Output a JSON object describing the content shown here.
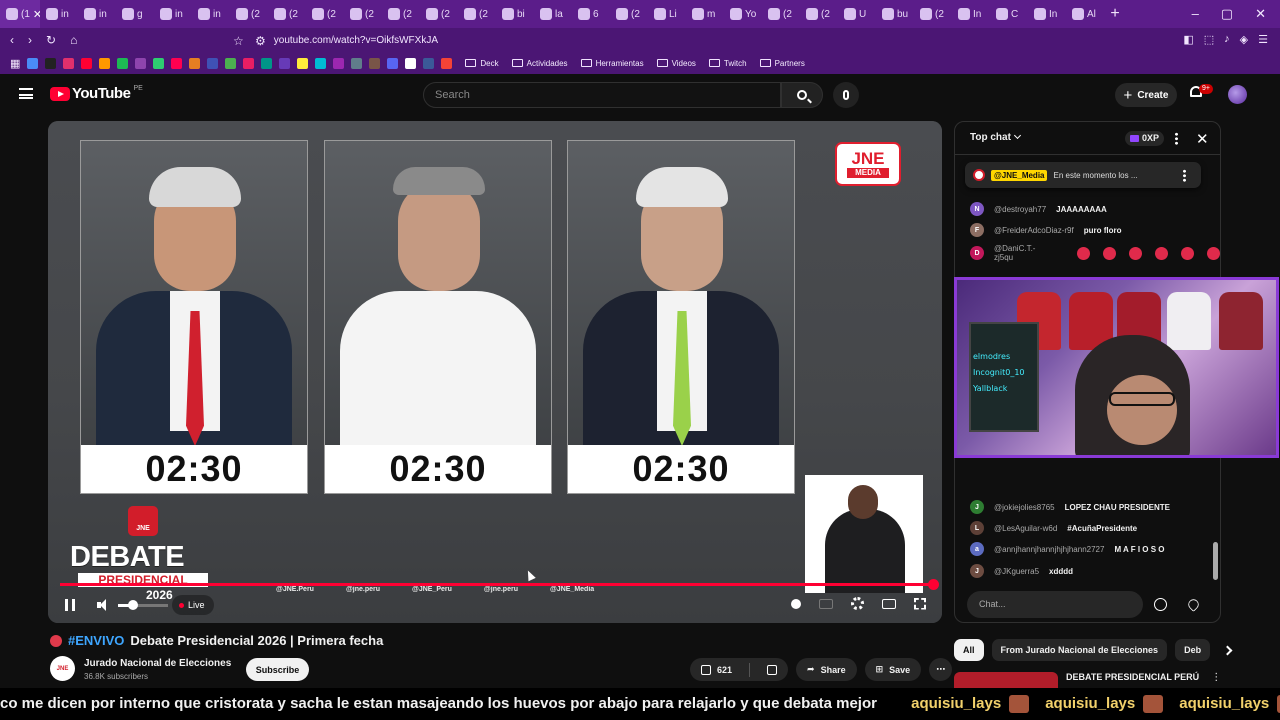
{
  "browser": {
    "tabs": [
      "(1",
      "in",
      "in",
      "g",
      "in",
      "in",
      "(2",
      "(2",
      "(2",
      "(2",
      "(2",
      "(2",
      "(2",
      "bi",
      "la",
      "6",
      "(2",
      "Li",
      "m",
      "Yo",
      "(2",
      "(2",
      "U",
      "bu",
      "(2",
      "In",
      "C",
      "In",
      "Al"
    ],
    "url": "youtube.com/watch?v=OikfsWFXkJA",
    "bookmarks": [
      {
        "label": "Deck"
      },
      {
        "label": "Actividades"
      },
      {
        "label": "Herramientas"
      },
      {
        "label": "Videos"
      },
      {
        "label": "Twitch"
      },
      {
        "label": "Partners"
      }
    ]
  },
  "yt": {
    "logo": "YouTube",
    "region": "PE",
    "search_placeholder": "Search",
    "create_label": "Create",
    "notif_badge": "9+"
  },
  "player": {
    "timers": [
      "02:30",
      "02:30",
      "02:30"
    ],
    "jne_logo_top": "JNE",
    "jne_logo_bottom": "MEDIA",
    "debate_badge": "JNE",
    "debate_line1": "DEBATE",
    "debate_line2": "PRESIDENCIAL",
    "debate_line3": "2026",
    "socials": [
      "@JNE.Peru",
      "@jne.peru",
      "@JNE_Peru",
      "@jne.peru",
      "@JNE_Media"
    ],
    "live_label": "Live",
    "volume_fraction": 0.3
  },
  "video": {
    "hashtag": "#ENVIVO",
    "title": "Debate Presidencial 2026 | Primera fecha",
    "channel": "Jurado Nacional de Elecciones",
    "channel_avatar_text": "JNE",
    "subscribers": "36.8K subscribers",
    "subscribe_label": "Subscribe",
    "likes": "621",
    "share_label": "Share",
    "save_label": "Save"
  },
  "chat": {
    "title": "Top chat",
    "xp_label": "0XP",
    "pinned_author": "@JNE_Media",
    "pinned_text": "En este momento los ...",
    "messages": [
      {
        "initial": "N",
        "color": "#7e57c2",
        "author": "@destroyah77",
        "text": "JAAAAAAAA"
      },
      {
        "initial": "F",
        "color": "#8d6e63",
        "author": "@FreiderAdcoDiaz-r9f",
        "text": "puro floro"
      },
      {
        "initial": "D",
        "color": "#c2185b",
        "author": "@DaniC.T.-zj5qu",
        "text": ""
      },
      {
        "initial": "J",
        "color": "#2e7d32",
        "author": "@jokiejolies8765",
        "text": "LOPEZ CHAU PRESIDENTE"
      },
      {
        "initial": "L",
        "color": "#5d4037",
        "author": "@LesAguilar-w6d",
        "text": "#AcuñaPresidente"
      },
      {
        "initial": "a",
        "color": "#5c6bc0",
        "author": "@annjhannjhannjhjhjhann2727",
        "text": "M A F I O S O"
      },
      {
        "initial": "J",
        "color": "#6d4c41",
        "author": "@JKguerra5",
        "text": "xdddd"
      }
    ],
    "input_placeholder": "Chat...",
    "overlay_board": [
      "elmodres",
      "Incognit0_10",
      "Yallblack"
    ]
  },
  "suggestions": {
    "chips": [
      "All",
      "From Jurado Nacional de Elecciones",
      "Deb"
    ],
    "next_title": "DEBATE PRESIDENCIAL PERÚ"
  },
  "ticker": {
    "message": "co me dicen por interno que cristorata y sacha le estan masajeando los huevos por abajo para relajarlo y que debata mejor",
    "users": [
      "aquisiu_lays",
      "aquisiu_lays",
      "aquisiu_lays"
    ]
  },
  "colors": {
    "browser_chrome": "#5b1d8a",
    "yt_red": "#ff0033",
    "overlay_border": "#8a3ad6"
  }
}
